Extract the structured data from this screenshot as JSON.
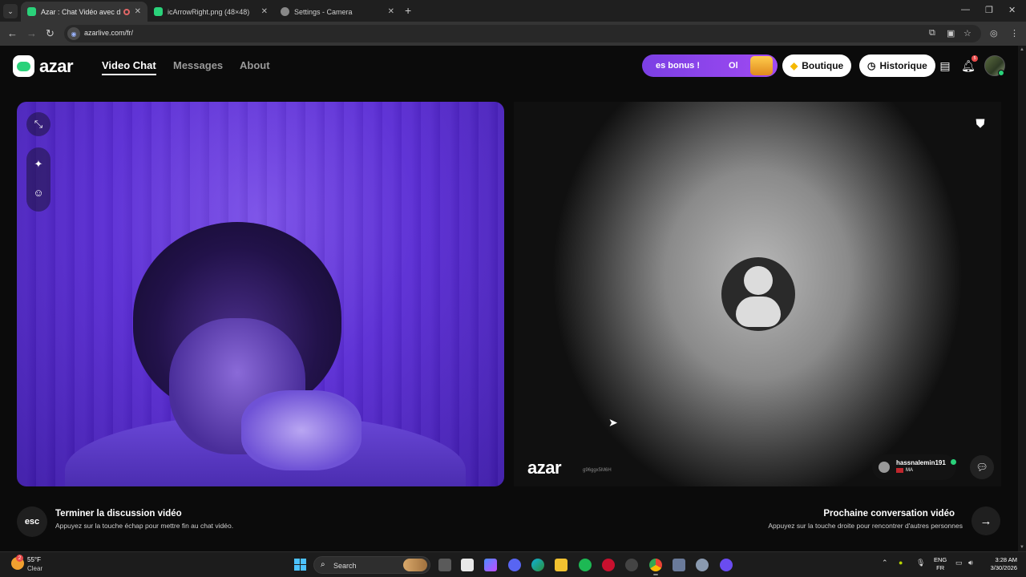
{
  "browser": {
    "tabs": [
      {
        "title": "Azar : Chat Vidéo avec de n",
        "active": true
      },
      {
        "title": "icArrowRight.png (48×48)",
        "active": false
      },
      {
        "title": "Settings - Camera",
        "active": false
      }
    ],
    "url": "azarlive.com/fr/"
  },
  "header": {
    "logo_text": "azar",
    "nav": [
      {
        "label": "Video Chat",
        "active": true
      },
      {
        "label": "Messages",
        "active": false
      },
      {
        "label": "About",
        "active": false
      }
    ],
    "bonus_text1": "es bonus !",
    "bonus_text2": "Ol",
    "shop_label": "Boutique",
    "history_label": "Historique",
    "notification_count": "5"
  },
  "remote": {
    "watermark": "azar",
    "watermark_id": "g96ggx5M6H",
    "username": "hassnalemin191",
    "country": "MA"
  },
  "footer": {
    "esc_label": "esc",
    "end_title": "Terminer la discussion vidéo",
    "end_subtitle": "Appuyez sur la touche échap pour mettre fin au chat vidéo.",
    "next_title": "Prochaine conversation vidéo",
    "next_subtitle": "Appuyez sur la touche droite pour rencontrer d'autres personnes"
  },
  "taskbar": {
    "weather_badge": "2",
    "temperature": "55°F",
    "condition": "Clear",
    "search_label": "Search",
    "lang_line1": "ENG",
    "lang_line2": "FR",
    "time": "3:28 AM",
    "date": "3/30/2026"
  },
  "colors": {
    "brand_green": "#2ad27a",
    "bonus_purple": "#8b45ea",
    "local_video": "#5a2cd4"
  }
}
